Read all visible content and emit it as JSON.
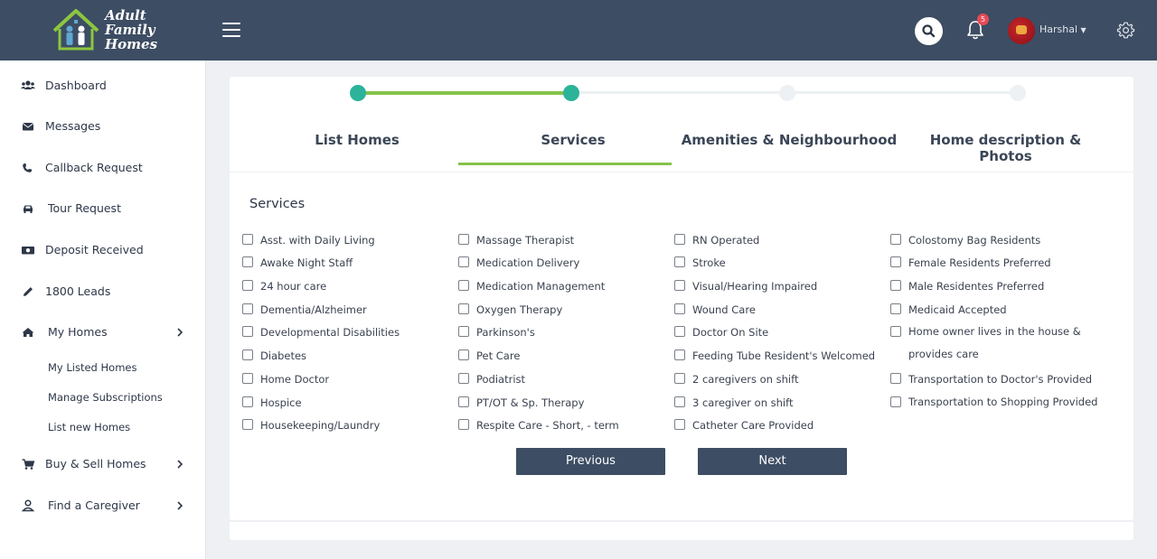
{
  "header": {
    "logo_lines": [
      "Adult",
      "Family",
      "Homes"
    ],
    "notification_count": "5",
    "user_name": "Harshal",
    "icons": [
      "menu-icon",
      "search-icon",
      "bell-icon",
      "settings-icon"
    ]
  },
  "sidebar": {
    "items": [
      {
        "label": "Dashboard",
        "icon": "users-icon"
      },
      {
        "label": "Messages",
        "icon": "envelope-icon"
      },
      {
        "label": "Callback Request",
        "icon": "phone-icon"
      },
      {
        "label": "Tour Request",
        "icon": "car-icon"
      },
      {
        "label": "Deposit Received",
        "icon": "money-icon"
      },
      {
        "label": "1800 Leads",
        "icon": "pencil-icon"
      },
      {
        "label": "My Homes",
        "icon": "home-icon"
      },
      {
        "label": "Buy & Sell Homes",
        "icon": "cart-icon"
      },
      {
        "label": "Find a Caregiver",
        "icon": "user-icon"
      }
    ],
    "subitems": [
      "My Listed Homes",
      "Manage Subscriptions",
      "List new Homes"
    ]
  },
  "wizard": {
    "steps": [
      "List Homes",
      "Services",
      "Amenities & Neighbourhood",
      "Home description & Photos"
    ],
    "active_step": "Services",
    "completed_steps": 2,
    "section_title": "Services"
  },
  "services": {
    "col1": [
      "Asst. with Daily Living",
      "Awake Night Staff",
      "24 hour care",
      "Dementia/Alzheimer",
      "Developmental Disabilities",
      "Diabetes",
      "Home Doctor",
      "Hospice",
      "Housekeeping/Laundry"
    ],
    "col2": [
      "Massage Therapist",
      "Medication Delivery",
      "Medication Management",
      "Oxygen Therapy",
      "Parkinson's",
      "Pet Care",
      "Podiatrist",
      "PT/OT & Sp. Therapy",
      "Respite Care - Short, - term"
    ],
    "col3": [
      "RN Operated",
      "Stroke",
      "Visual/Hearing Impaired",
      "Wound Care",
      "Doctor On Site",
      "Feeding Tube Resident's Welcomed",
      "2 caregivers on shift",
      "3 caregiver on shift",
      "Catheter Care Provided"
    ],
    "col4": [
      "Colostomy Bag Residents",
      "Female Residents Preferred",
      "Male Residentes Preferred",
      "Medicaid Accepted",
      "Home owner lives in the house & provides care",
      "Transportation to Doctor's Provided",
      "Transportation to Shopping Provided"
    ]
  },
  "buttons": {
    "previous": "Previous",
    "next": "Next"
  },
  "colors": {
    "header_bg": "#3d4d63",
    "accent_green": "#86c24a",
    "step_teal": "#2cb39a",
    "badge_red": "#e84a55"
  }
}
